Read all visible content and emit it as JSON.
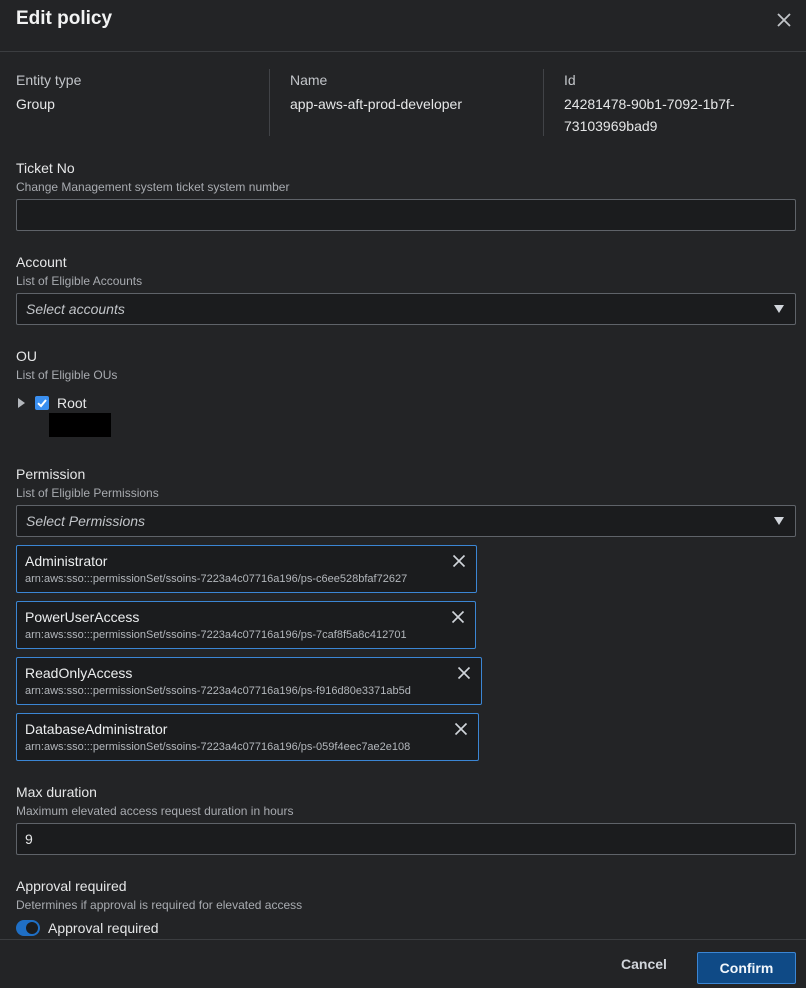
{
  "dialog": {
    "title": "Edit policy"
  },
  "entity": {
    "type_label": "Entity type",
    "type_value": "Group",
    "name_label": "Name",
    "name_value": "app-aws-aft-prod-developer",
    "id_label": "Id",
    "id_value_line1": "24281478-90b1-7092-1b7f-",
    "id_value_line2": "73103969bad9"
  },
  "ticket": {
    "label": "Ticket No",
    "description": "Change Management system ticket system number",
    "value": ""
  },
  "account": {
    "label": "Account",
    "description": "List of Eligible Accounts",
    "placeholder": "Select accounts"
  },
  "ou": {
    "label": "OU",
    "description": "List of Eligible OUs",
    "tree": [
      {
        "label": "Root",
        "checked": true
      }
    ]
  },
  "permission": {
    "label": "Permission",
    "description": "List of Eligible Permissions",
    "placeholder": "Select Permissions",
    "selected": [
      {
        "name": "Administrator",
        "arn": "arn:aws:sso:::permissionSet/ssoins-7223a4c07716a196/ps-c6ee528bfaf72627"
      },
      {
        "name": "PowerUserAccess",
        "arn": "arn:aws:sso:::permissionSet/ssoins-7223a4c07716a196/ps-7caf8f5a8c412701"
      },
      {
        "name": "ReadOnlyAccess",
        "arn": "arn:aws:sso:::permissionSet/ssoins-7223a4c07716a196/ps-f916d80e3371ab5d"
      },
      {
        "name": "DatabaseAdministrator",
        "arn": "arn:aws:sso:::permissionSet/ssoins-7223a4c07716a196/ps-059f4eec7ae2e108"
      }
    ]
  },
  "duration": {
    "label": "Max duration",
    "description": "Maximum elevated access request duration in hours",
    "value": "9"
  },
  "approval": {
    "label": "Approval required",
    "description": "Determines if approval is required for elevated access",
    "toggle_label": "Approval required",
    "enabled": true
  },
  "footer": {
    "cancel_label": "Cancel",
    "confirm_label": "Confirm"
  },
  "colors": {
    "background": "#232426",
    "accent": "#3b86d4",
    "primary_button": "#0f4a86"
  }
}
